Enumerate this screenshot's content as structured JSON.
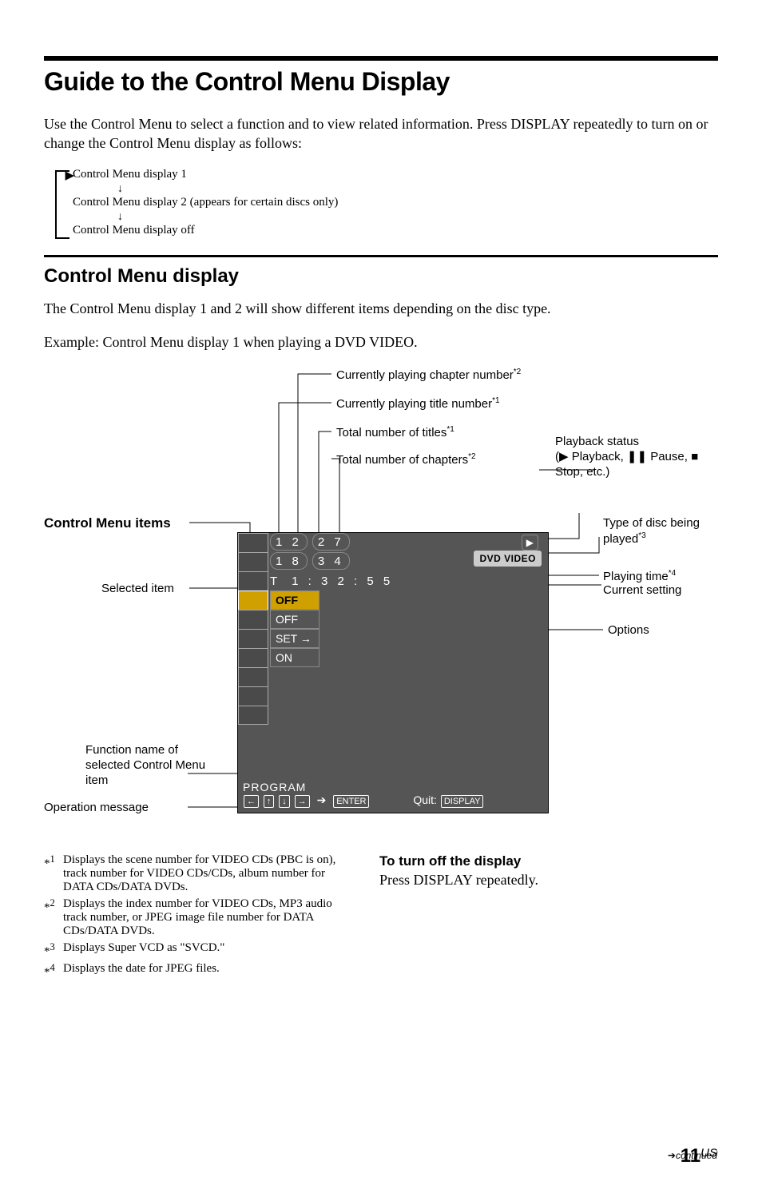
{
  "title": "Guide to the Control Menu Display",
  "intro": "Use the Control Menu to select a function and to view related information. Press DISPLAY repeatedly to turn on or change the Control Menu display as follows:",
  "cycle": {
    "line1": "Control Menu display 1",
    "line2": "Control Menu display 2 (appears for certain discs only)",
    "line3": "Control Menu display off"
  },
  "section_heading": "Control Menu display",
  "section_body1": "The Control Menu display 1 and 2 will show different items depending on the disc type.",
  "section_body2": "Example: Control Menu display 1 when playing a DVD VIDEO.",
  "diagram": {
    "labels": {
      "currently_playing_chapter": "Currently playing chapter number",
      "currently_playing_title": "Currently playing title number",
      "total_titles": "Total number of titles",
      "total_chapters": "Total number of chapters",
      "playback_status": "Playback status",
      "playback_status_sub": "(▶ Playback, ❚❚ Pause, ■ Stop, etc.)",
      "type_of_disc": "Type of disc being played",
      "playing_time": "Playing time",
      "current_setting": "Current setting",
      "options": "Options",
      "control_menu_items": "Control Menu items",
      "selected_item": "Selected item",
      "function_name": "Function name of selected Control Menu item",
      "operation_message": "Operation message"
    },
    "menu": {
      "row1_left": "1 2",
      "row1_right": "2 7",
      "row2_left": "1 8",
      "row2_right": "3 4",
      "time_prefix": "T",
      "time_value": "1 : 3 2 : 5 5",
      "opt1": "OFF",
      "opt2": "OFF",
      "opt3": "SET →",
      "opt4": "ON",
      "disc_badge": "DVD VIDEO",
      "bottom_name": "PROGRAM",
      "enter_label": "ENTER",
      "quit_label": "Quit:",
      "display_label": "DISPLAY"
    }
  },
  "footnotes": {
    "fn1": "Displays the scene number for VIDEO CDs (PBC is on), track number for VIDEO CDs/CDs, album number for DATA CDs/DATA DVDs.",
    "fn2": "Displays the index number for VIDEO CDs, MP3 audio track number, or JPEG image file number for DATA CDs/DATA DVDs.",
    "fn3": "Displays Super VCD as \"SVCD.\"",
    "fn4": "Displays the date for JPEG files."
  },
  "turn_off": {
    "heading": "To turn off the display",
    "body": "Press DISPLAY repeatedly."
  },
  "continued": "continued",
  "page_number": "11",
  "page_suffix": "US",
  "sup": {
    "s1": "*1",
    "s2": "*2",
    "s3": "*3",
    "s4": "*4"
  }
}
